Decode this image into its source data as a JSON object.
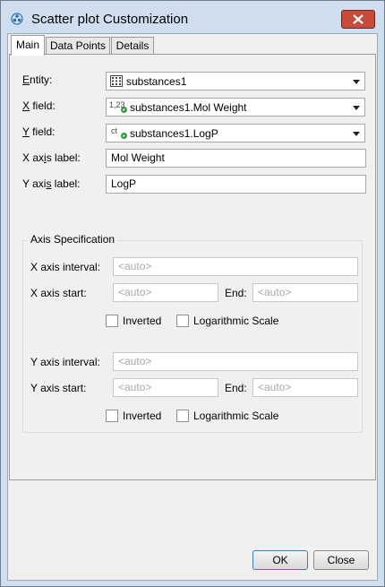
{
  "window": {
    "title": "Scatter plot Customization"
  },
  "tabs": [
    {
      "label": "Main"
    },
    {
      "label": "Data Points"
    },
    {
      "label": "Details"
    }
  ],
  "main": {
    "entity": {
      "label": "Entity:",
      "value": "substances1",
      "icon": "table-grid-icon"
    },
    "x_field": {
      "label": "X field:",
      "value": "substances1.Mol Weight",
      "icon": "numeric-field-icon",
      "icon_text": "1,23"
    },
    "y_field": {
      "label": "Y field:",
      "value": "substances1.LogP",
      "icon": "numeric-field-icon",
      "icon_text": "ct"
    },
    "x_axis_label": {
      "label": "X axis label:",
      "value": "Mol Weight"
    },
    "y_axis_label": {
      "label": "Y axis label:",
      "value": "LogP"
    },
    "axis_spec": {
      "title": "Axis Specification",
      "x_interval": {
        "label": "X axis interval:",
        "placeholder": "<auto>"
      },
      "x_start": {
        "label": "X axis start:",
        "placeholder": "<auto>"
      },
      "x_end": {
        "label": "End:",
        "placeholder": "<auto>"
      },
      "x_inverted": {
        "label": "Inverted",
        "checked": false
      },
      "x_log": {
        "label": "Logarithmic Scale",
        "checked": false
      },
      "y_interval": {
        "label": "Y axis interval:",
        "placeholder": "<auto>"
      },
      "y_start": {
        "label": "Y axis start:",
        "placeholder": "<auto>"
      },
      "y_end": {
        "label": "End:",
        "placeholder": "<auto>"
      },
      "y_inverted": {
        "label": "Inverted",
        "checked": false
      },
      "y_log": {
        "label": "Logarithmic Scale",
        "checked": false
      }
    }
  },
  "buttons": {
    "ok": "OK",
    "close": "Close"
  },
  "colors": {
    "titlebar": "#cfdff0",
    "close_button": "#c74a3b",
    "panel": "#f0f0f0",
    "default_button_border": "#3c7fb1"
  }
}
